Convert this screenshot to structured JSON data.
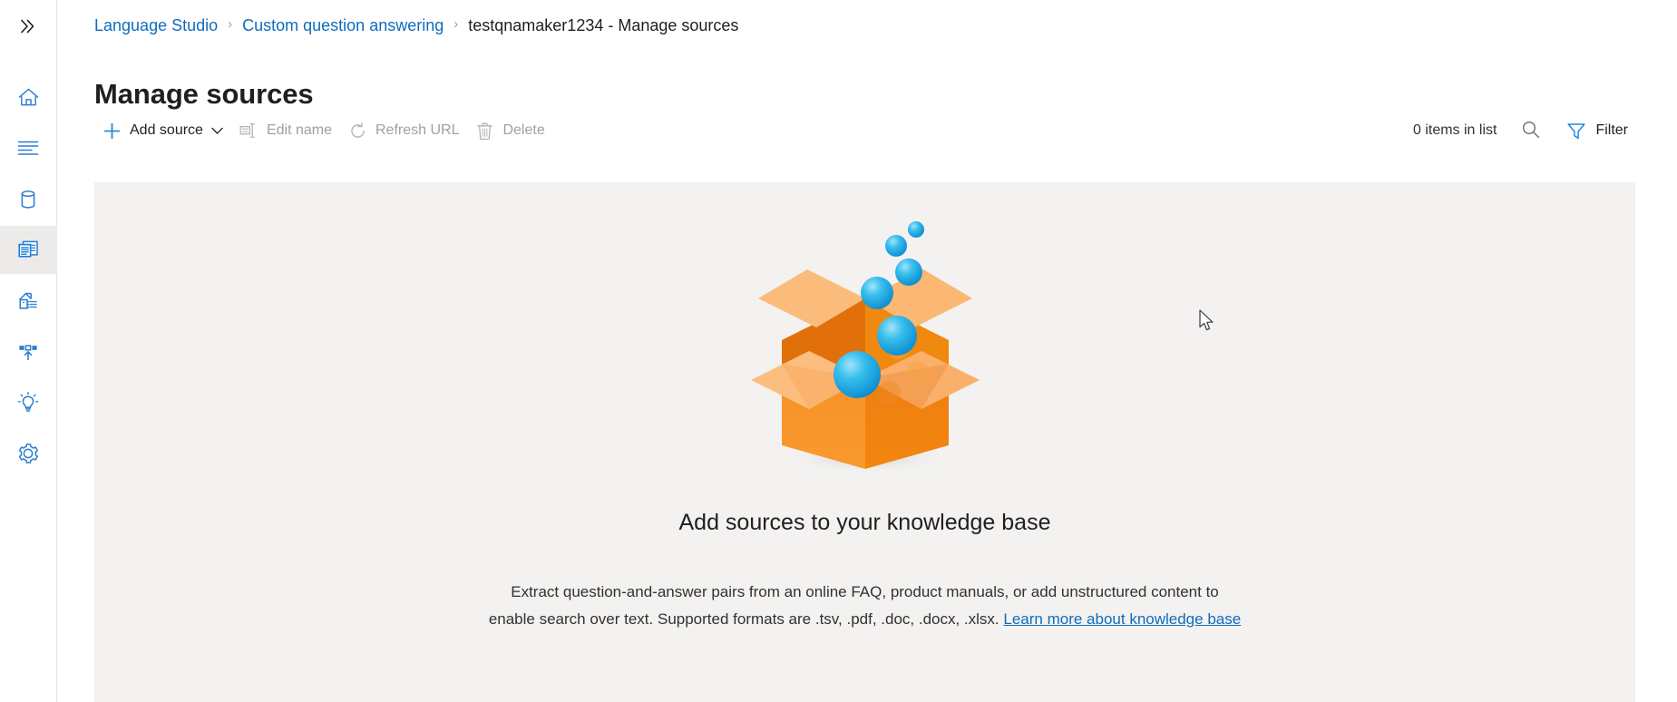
{
  "rail": {
    "items": [
      {
        "name": "expand-nav",
        "icon": "chevron-double-right-icon",
        "label": "Expand navigation",
        "selected": false
      },
      {
        "name": "home",
        "icon": "home-icon",
        "label": "Home",
        "selected": false
      },
      {
        "name": "text-lines",
        "icon": "text-lines-icon",
        "label": "Projects",
        "selected": false
      },
      {
        "name": "database",
        "icon": "database-icon",
        "label": "Data",
        "selected": false
      },
      {
        "name": "manage-sources",
        "icon": "pages-icon",
        "label": "Manage sources",
        "selected": true
      },
      {
        "name": "train-model",
        "icon": "crane-icon",
        "label": "Train model",
        "selected": false
      },
      {
        "name": "deploy-model",
        "icon": "deploy-upload-icon",
        "label": "Deploy model",
        "selected": false
      },
      {
        "name": "test-model",
        "icon": "lightbulb-icon",
        "label": "Test model",
        "selected": false
      },
      {
        "name": "settings",
        "icon": "gear-icon",
        "label": "Settings",
        "selected": false
      }
    ]
  },
  "breadcrumb": {
    "items": [
      {
        "label": "Language Studio",
        "type": "link"
      },
      {
        "label": "Custom question answering",
        "type": "link"
      },
      {
        "label": "testqnamaker1234 - Manage sources",
        "type": "current"
      }
    ],
    "separator": "›"
  },
  "page": {
    "title": "Manage sources"
  },
  "toolbar": {
    "add_source_label": "Add source",
    "edit_name_label": "Edit name",
    "refresh_url_label": "Refresh URL",
    "delete_label": "Delete",
    "items_count_label": "0 items in list",
    "filter_label": "Filter",
    "search_title": "Search",
    "disabled": {
      "edit_name": true,
      "refresh_url": true,
      "delete": true
    }
  },
  "empty_state": {
    "heading": "Add sources to your knowledge base",
    "body_before_link": "Extract question-and-answer pairs from an online FAQ, product manuals, or add unstructured content to enable search over text. Supported formats are .tsv, .pdf, .doc, .docx, .xlsx. ",
    "link_label": "Learn more about knowledge base",
    "illustration": "open-box-with-blue-spheres"
  },
  "colors": {
    "accent_blue": "#0f6cbd",
    "icon_blue": "#2b88d8",
    "panel_gray": "#f3f2f1",
    "selected_gray": "#edebe9",
    "text_primary": "#201f1e",
    "text_disabled": "#a19f9d",
    "box_orange_dark": "#e06c04",
    "box_orange": "#f7941e",
    "box_orange_light": "#fcbb74",
    "sphere_blue": "#29b6e8"
  }
}
